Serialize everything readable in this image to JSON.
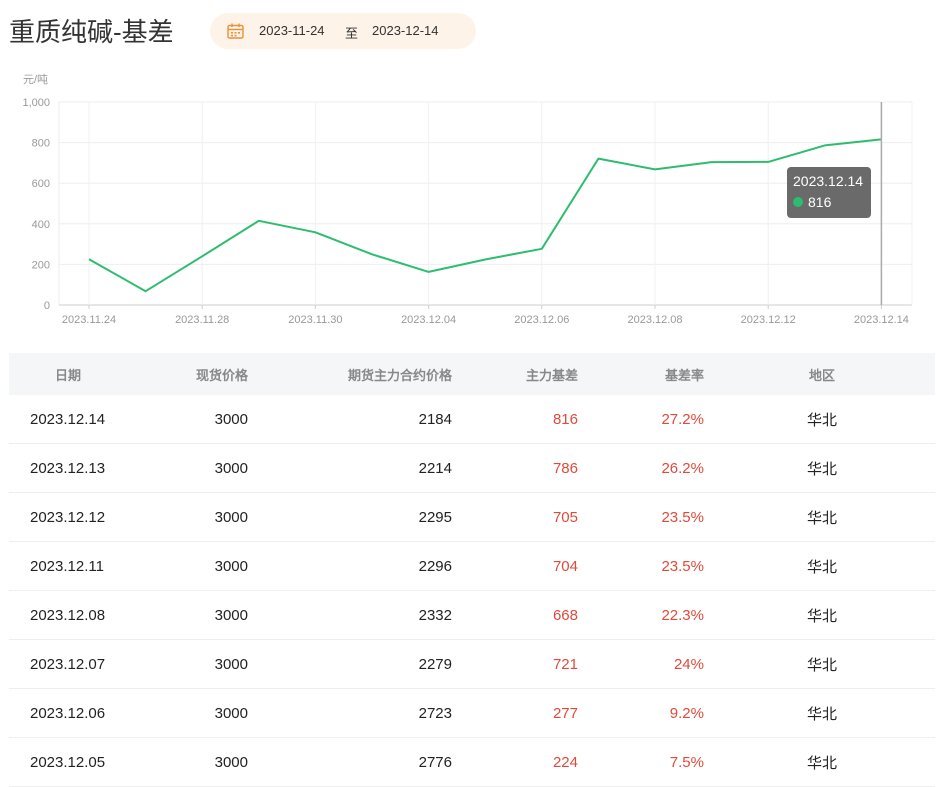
{
  "header": {
    "title": "重质纯碱-基差",
    "date_start": "2023-11-24",
    "date_sep": "至",
    "date_end": "2023-12-14"
  },
  "colors": {
    "line": "#2dbd6e",
    "accent_orange": "#e8913a",
    "basis_red": "#e04a3a"
  },
  "icons": {
    "date": "calendar-icon"
  },
  "chart_data": {
    "type": "line",
    "ylabel": "元/吨",
    "ylim": [
      0,
      1000
    ],
    "yticks": [
      0,
      200,
      400,
      600,
      800,
      1000
    ],
    "ytick_labels": [
      "0",
      "200",
      "400",
      "600",
      "800",
      "1,000"
    ],
    "x": [
      "2023.11.24",
      "2023.11.27",
      "2023.11.28",
      "2023.11.29",
      "2023.11.30",
      "2023.12.01",
      "2023.12.04",
      "2023.12.05",
      "2023.12.06",
      "2023.12.07",
      "2023.12.08",
      "2023.12.11",
      "2023.12.12",
      "2023.12.13",
      "2023.12.14"
    ],
    "xtick_labels": [
      "2023.11.24",
      "2023.11.28",
      "2023.11.30",
      "2023.12.04",
      "2023.12.06",
      "2023.12.08",
      "2023.12.12",
      "2023.12.14"
    ],
    "series": [
      {
        "values": [
          225,
          68,
          240,
          415,
          358,
          250,
          163,
          224,
          277,
          721,
          668,
          704,
          705,
          786,
          816
        ]
      }
    ],
    "grid": true,
    "tooltip": {
      "date": "2023.12.14",
      "value": "816"
    }
  },
  "table": {
    "headers": [
      "日期",
      "现货价格",
      "期货主力合约价格",
      "主力基差",
      "基差率",
      "地区"
    ],
    "rows": [
      [
        "2023.12.14",
        "3000",
        "2184",
        "816",
        "27.2%",
        "华北"
      ],
      [
        "2023.12.13",
        "3000",
        "2214",
        "786",
        "26.2%",
        "华北"
      ],
      [
        "2023.12.12",
        "3000",
        "2295",
        "705",
        "23.5%",
        "华北"
      ],
      [
        "2023.12.11",
        "3000",
        "2296",
        "704",
        "23.5%",
        "华北"
      ],
      [
        "2023.12.08",
        "3000",
        "2332",
        "668",
        "22.3%",
        "华北"
      ],
      [
        "2023.12.07",
        "3000",
        "2279",
        "721",
        "24%",
        "华北"
      ],
      [
        "2023.12.06",
        "3000",
        "2723",
        "277",
        "9.2%",
        "华北"
      ],
      [
        "2023.12.05",
        "3000",
        "2776",
        "224",
        "7.5%",
        "华北"
      ]
    ]
  }
}
